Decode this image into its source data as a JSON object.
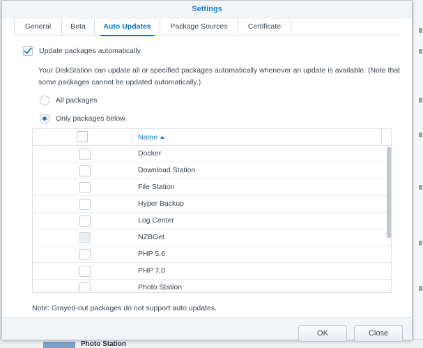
{
  "window": {
    "title": "Settings"
  },
  "tabs": [
    {
      "label": "General"
    },
    {
      "label": "Beta"
    },
    {
      "label": "Auto Updates"
    },
    {
      "label": "Package Sources"
    },
    {
      "label": "Certificate"
    }
  ],
  "active_tab": "Auto Updates",
  "auto_update": {
    "checkbox_label": "Update packages automatically",
    "checked": true,
    "description": "Your DiskStation can update all or specified packages automatically whenever an update is available. (Note that some packages cannot be updated automatically.)",
    "options": [
      {
        "label": "All packages",
        "selected": false
      },
      {
        "label": "Only packages below",
        "selected": true
      }
    ]
  },
  "packages": {
    "header_name": "Name",
    "sort": "ascending",
    "rows": [
      {
        "name": "Docker",
        "disabled": false
      },
      {
        "name": "Download Station",
        "disabled": false
      },
      {
        "name": "File Station",
        "disabled": false
      },
      {
        "name": "Hyper Backup",
        "disabled": false
      },
      {
        "name": "Log Center",
        "disabled": false
      },
      {
        "name": "NZBGet",
        "disabled": true
      },
      {
        "name": "PHP 5.6",
        "disabled": false
      },
      {
        "name": "PHP 7.0",
        "disabled": false
      },
      {
        "name": "Photo Station",
        "disabled": false
      }
    ]
  },
  "note": "Note: Grayed-out packages do not support auto updates.",
  "buttons": {
    "ok": "OK",
    "close": "Close"
  },
  "background": {
    "partial_text": "Photo Station"
  },
  "colors": {
    "accent": "#0a72c8",
    "title": "#1f7fd2"
  }
}
